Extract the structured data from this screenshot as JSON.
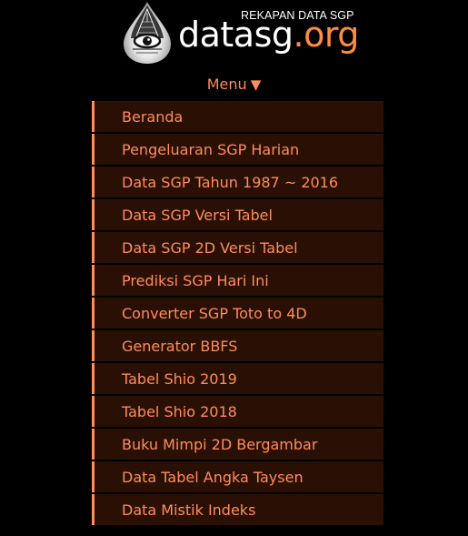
{
  "header": {
    "tagline": "REKAPAN DATA SGP",
    "brand_name": "datasg",
    "brand_tld": ".org",
    "emblem_icon": "eye-pyramid-icon"
  },
  "menu": {
    "toggle_label": "Menu",
    "toggle_arrow": "▼",
    "items": [
      {
        "label": "Beranda"
      },
      {
        "label": "Pengeluaran SGP Harian"
      },
      {
        "label": "Data SGP Tahun 1987 ~ 2016"
      },
      {
        "label": "Data SGP Versi Tabel"
      },
      {
        "label": "Data SGP 2D Versi Tabel"
      },
      {
        "label": "Prediksi SGP Hari Ini"
      },
      {
        "label": "Converter SGP Toto to 4D"
      },
      {
        "label": "Generator BBFS"
      },
      {
        "label": "Tabel Shio 2019"
      },
      {
        "label": "Tabel Shio 2018"
      },
      {
        "label": "Buku Mimpi 2D Bergambar"
      },
      {
        "label": "Data Tabel Angka Taysen"
      },
      {
        "label": "Data Mistik Indeks"
      }
    ]
  },
  "colors": {
    "background": "#000000",
    "accent": "#ff8c5a",
    "menu_item_bg": "#2a1004",
    "brand_tld": "#ff8c42"
  }
}
